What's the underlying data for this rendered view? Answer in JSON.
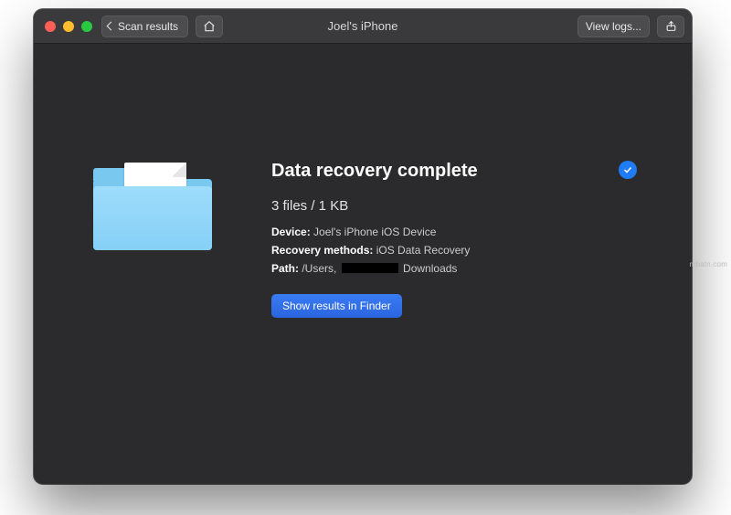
{
  "titlebar": {
    "back_label": "Scan results",
    "title": "Joel's iPhone",
    "view_logs_label": "View logs..."
  },
  "result": {
    "heading": "Data recovery complete",
    "summary": "3 files / 1 KB",
    "device_label": "Device:",
    "device_value": "Joel's iPhone iOS Device",
    "methods_label": "Recovery methods:",
    "methods_value": "iOS Data Recovery",
    "path_label": "Path:",
    "path_prefix": "/Users,",
    "path_suffix": "Downloads",
    "cta_label": "Show results in Finder"
  },
  "watermark": "mbatn.com"
}
